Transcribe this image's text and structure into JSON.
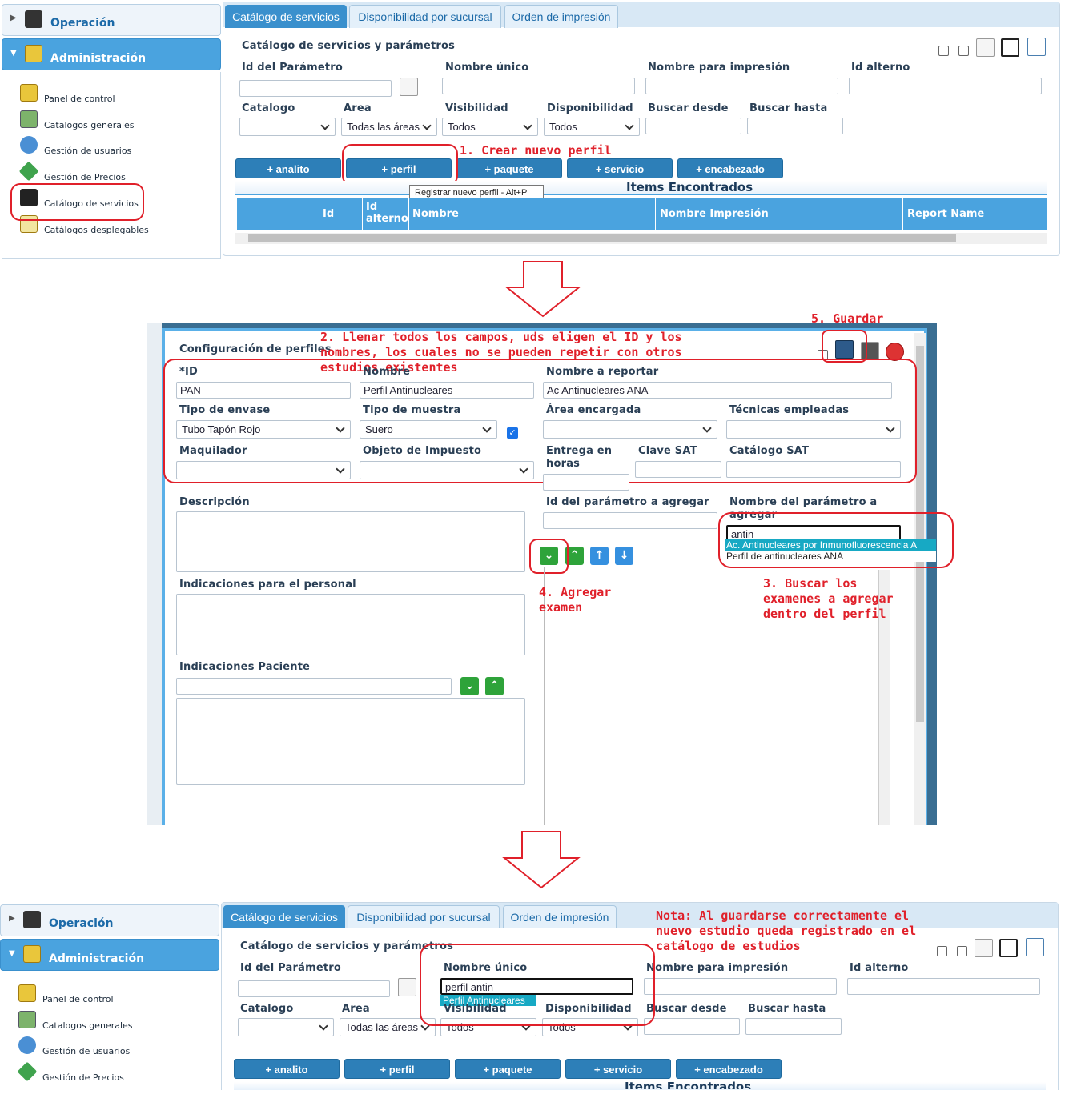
{
  "sidebar": {
    "operacion": "Operación",
    "administracion": "Administración",
    "items": [
      {
        "label": "Panel de control",
        "icon": "panel-icon"
      },
      {
        "label": "Catalogos generales",
        "icon": "catalog-icon"
      },
      {
        "label": "Gestión de usuarios",
        "icon": "user-icon"
      },
      {
        "label": "Gestión de Precios",
        "icon": "price-tag-icon"
      },
      {
        "label": "Catálogo de servicios",
        "icon": "microscope-icon"
      },
      {
        "label": "Catálogos desplegables",
        "icon": "list-icon"
      }
    ]
  },
  "tabs": [
    "Catálogo de servicios",
    "Disponibilidad por sucursal",
    "Orden de impresión"
  ],
  "catalog": {
    "title": "Catálogo de servicios y parámetros",
    "labels": {
      "id": "Id del Parámetro",
      "nombre_unico": "Nombre único",
      "nombre_impresion": "Nombre para impresión",
      "id_alterno": "Id alterno",
      "catalogo": "Catalogo",
      "area": "Area",
      "visibilidad": "Visibilidad",
      "disponibilidad": "Disponibilidad",
      "buscar_desde": "Buscar desde",
      "buscar_hasta": "Buscar hasta"
    },
    "values": {
      "area": "Todas las áreas",
      "visibilidad": "Todos",
      "disponibilidad": "Todos",
      "nombre_unico_bottom": "perfil antin",
      "autocomplete_bottom": "Perfil Antinucleares"
    },
    "buttons": [
      "+ analito",
      "+ perfil",
      "+ paquete",
      "+ servicio",
      "+ encabezado"
    ],
    "tooltip": "Registrar nuevo perfil - Alt+P",
    "items_title": "Items Encontrados",
    "columns": [
      "Id",
      "Id alterno",
      "Nombre",
      "Nombre Impresión",
      "Report Name"
    ]
  },
  "dialog": {
    "title": "Configuración de perfiles",
    "labels": {
      "id": "*ID",
      "nombre": "Nombre",
      "nombre_reportar": "Nombre a reportar",
      "tipo_envase": "Tipo de envase",
      "tipo_muestra": "Tipo de muestra",
      "area_encargada": "Área encargada",
      "tecnicas": "Técnicas empleadas",
      "maquilador": "Maquilador",
      "objeto_impuesto": "Objeto de Impuesto",
      "entrega": "Entrega en horas",
      "clave_sat": "Clave SAT",
      "catalogo_sat": "Catálogo SAT",
      "descripcion": "Descripción",
      "id_param_agregar": "Id del parámetro a agregar",
      "nombre_param_agregar": "Nombre del parámetro a agregar",
      "indicaciones_personal": "Indicaciones para el personal",
      "indicaciones_paciente": "Indicaciones Paciente"
    },
    "values": {
      "id": "PAN",
      "nombre": "Perfil Antinucleares",
      "nombre_reportar": "Ac Antinucleares ANA",
      "tipo_envase": "Tubo Tapón Rojo",
      "tipo_muestra": "Suero",
      "buscar_param": "antin"
    },
    "suggestions": [
      "Ac. Antinucleares por Inmunofluorescencia A",
      "Perfil de antinucleares ANA"
    ]
  },
  "annotations": {
    "step1": "1. Crear nuevo perfil",
    "step2": "2. Llenar todos los campos, uds eligen el ID y los nombres, los cuales no se pueden repetir con otros estudios existentes",
    "step3": "3. Buscar los examenes a agregar dentro del perfil",
    "step4": "4. Agregar examen",
    "step5": "5. Guardar",
    "nota": "Nota: Al guardarse correctamente el nuevo estudio queda registrado en el catálogo de estudios"
  },
  "colors": {
    "accent": "#2d7fb8",
    "header": "#4aa3df",
    "annotation": "#e0202a",
    "active_tab": "#3a90cd"
  }
}
